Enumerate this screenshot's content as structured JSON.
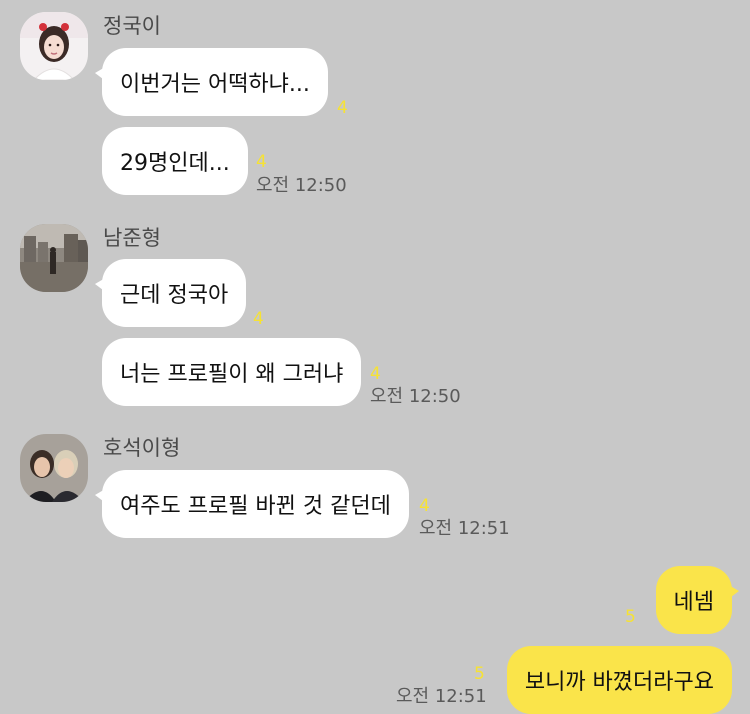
{
  "colors": {
    "background": "#c8c8c8",
    "incoming_bubble": "#ffffff",
    "outgoing_bubble": "#fae44a",
    "unread_count": "#f6e234"
  },
  "groups": [
    {
      "sender": "정국이",
      "avatar_icon": "profile-photo-jungkook-icon",
      "messages": [
        {
          "text": "이번거는 어떡하냐...",
          "unread": "4"
        },
        {
          "text": "29명인데...",
          "unread": "4"
        }
      ],
      "time": "오전 12:50"
    },
    {
      "sender": "남준형",
      "avatar_icon": "profile-photo-namjoon-icon",
      "messages": [
        {
          "text": "근데 정국아",
          "unread": "4"
        },
        {
          "text": "너는 프로필이 왜 그러냐",
          "unread": "4"
        }
      ],
      "time": "오전 12:50"
    },
    {
      "sender": "호석이형",
      "avatar_icon": "profile-photo-hoseok-icon",
      "messages": [
        {
          "text": "여주도 프로필 바뀐 것 같던데",
          "unread": "4"
        }
      ],
      "time": "오전 12:51"
    }
  ],
  "my_messages": [
    {
      "text": "네넴",
      "unread": "5"
    },
    {
      "text": "보니까 바꼈더라구요",
      "unread": "5"
    }
  ],
  "my_time": "오전 12:51"
}
